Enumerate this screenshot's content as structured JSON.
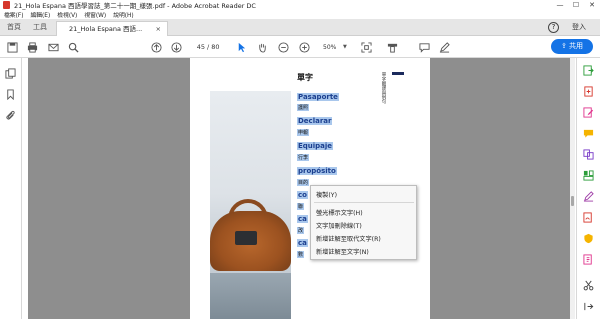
{
  "window": {
    "title": "21_Hola Espana 西語學習誌_第二十一期_樣張.pdf - Adobe Acrobat Reader DC",
    "controls": [
      "—",
      "☐",
      "✕"
    ]
  },
  "menu": [
    "檔案(F)",
    "編輯(E)",
    "檢視(V)",
    "視窗(W)",
    "說明(H)"
  ],
  "tabs": {
    "home": "首頁",
    "tools": "工具",
    "document": "21_Hola Espana 西語...",
    "close": "×",
    "help": "?",
    "signin": "登入"
  },
  "toolbar": {
    "current_page": "45",
    "total_pages": "/ 80",
    "zoom": "50%",
    "zoom_caret": "▼",
    "share_label": "共用"
  },
  "document": {
    "heading": "單字",
    "side_label": "單字翻譯與例句",
    "words": [
      {
        "word": "Pasaporte",
        "meaning": "護照"
      },
      {
        "word": "Declarar",
        "meaning": "申報"
      },
      {
        "word": "Equipaje",
        "meaning": "行李"
      },
      {
        "word": "propósito",
        "meaning": "目的"
      }
    ],
    "partial_rows": [
      {
        "word": "co",
        "meaning": "聯"
      },
      {
        "word": "ca",
        "meaning": "改"
      },
      {
        "word": "ca",
        "meaning": "數"
      }
    ]
  },
  "context_menu": {
    "items": [
      "複製(Y)",
      "螢光標示文字(H)",
      "文字加刪除線(T)",
      "新增註解至取代文字(R)",
      "新增註解至文字(N)"
    ]
  },
  "icons": {
    "left_rail": [
      "pages-icon",
      "bookmark-icon",
      "attachment-icon"
    ],
    "right_panel": [
      "export-pdf-icon",
      "create-pdf-icon",
      "edit-pdf-icon",
      "comment-icon",
      "combine-icon",
      "organize-icon",
      "fill-sign-icon",
      "send-for-signature-icon",
      "protect-icon",
      "more-tools-icon",
      "scissors-icon",
      "expand-icon"
    ]
  },
  "colors": {
    "accent": "#1473e6",
    "selection": "#a9c7ec",
    "word_text": "#1b3f8f",
    "canvas": "#8e8e8e"
  }
}
